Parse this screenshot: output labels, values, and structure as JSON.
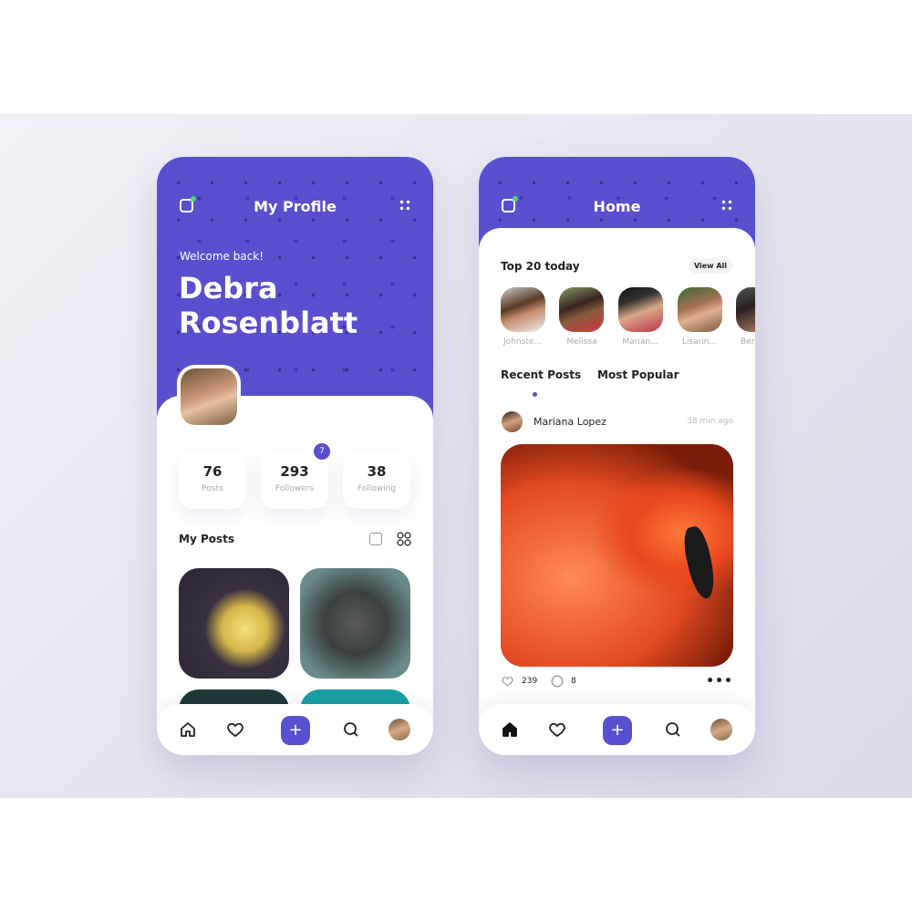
{
  "profile": {
    "title": "My Profile",
    "welcome": "Welcome back!",
    "name_first": "Debra",
    "name_last": "Rosenblatt",
    "stats": [
      {
        "value": "76",
        "label": "Posts"
      },
      {
        "value": "293",
        "label": "Followers"
      },
      {
        "value": "38",
        "label": "Following"
      }
    ],
    "followers_badge": "7",
    "my_posts_title": "My Posts"
  },
  "home": {
    "title": "Home",
    "top_title": "Top 20 today",
    "view_all": "View All",
    "stories": [
      "Johnste...",
      "Melissa",
      "Marian...",
      "Lisarin...",
      "Ber"
    ],
    "tabs": [
      "Recent Posts",
      "Most Popular"
    ],
    "active_tab": "Recent Posts",
    "post": {
      "author": "Mariana Lopez",
      "time": "38 min ago",
      "likes": "239",
      "comments": "8"
    }
  },
  "nav": {
    "plus": "+",
    "items": [
      "home",
      "heart",
      "add",
      "search",
      "profile"
    ]
  },
  "colors": {
    "accent": "#5a4fcf",
    "online": "#4cd964"
  }
}
